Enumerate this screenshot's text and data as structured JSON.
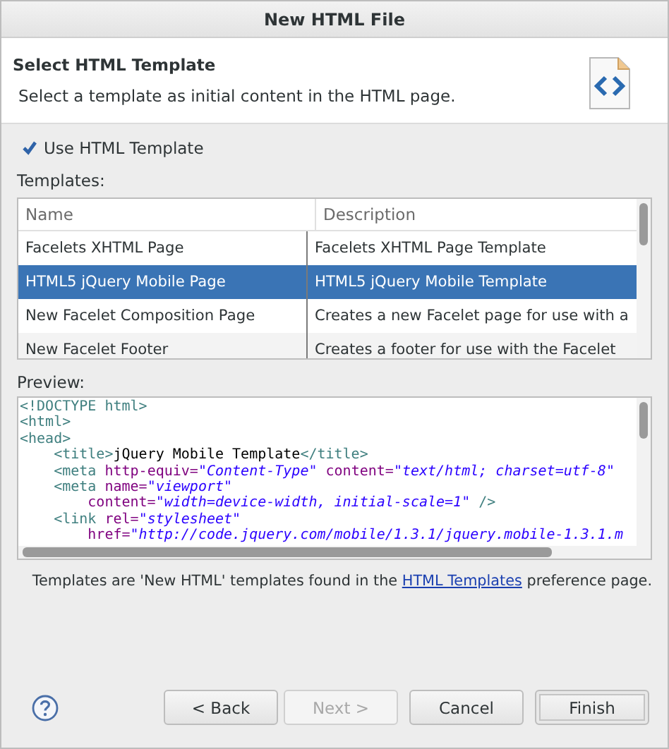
{
  "window": {
    "title": "New HTML File"
  },
  "header": {
    "title": "Select HTML Template",
    "description": "Select a template as initial content in the HTML page."
  },
  "use_template": {
    "label": "Use HTML Template",
    "checked": true
  },
  "templates": {
    "label": "Templates:",
    "columns": [
      "Name",
      "Description"
    ],
    "rows": [
      {
        "name": "Facelets XHTML Page",
        "description": "Facelets XHTML Page Template",
        "selected": false
      },
      {
        "name": "HTML5 jQuery Mobile Page",
        "description": "HTML5 jQuery Mobile Template",
        "selected": true
      },
      {
        "name": "New Facelet Composition Page",
        "description": "Creates a new Facelet page for use with a",
        "selected": false
      },
      {
        "name": "New Facelet Footer",
        "description": "Creates a footer for use with the Facelet",
        "selected": false
      }
    ]
  },
  "preview": {
    "label": "Preview:",
    "lines": [
      [
        {
          "kind": "tag",
          "text": "<!DOCTYPE html>"
        }
      ],
      [
        {
          "kind": "tag",
          "text": "<html>"
        }
      ],
      [
        {
          "kind": "tag",
          "text": "<head>"
        }
      ],
      [
        {
          "kind": "tag",
          "text": "    <title>"
        },
        {
          "kind": "text",
          "text": "jQuery Mobile Template"
        },
        {
          "kind": "tag",
          "text": "</title>"
        }
      ],
      [
        {
          "kind": "tag",
          "text": "    <meta "
        },
        {
          "kind": "attr",
          "text": "http-equiv="
        },
        {
          "kind": "value",
          "text": "\"Content-Type\""
        },
        {
          "kind": "attr",
          "text": " content="
        },
        {
          "kind": "value",
          "text": "\"text/html; charset=utf-8\""
        }
      ],
      [
        {
          "kind": "tag",
          "text": "    <meta "
        },
        {
          "kind": "attr",
          "text": "name="
        },
        {
          "kind": "value",
          "text": "\"viewport\""
        }
      ],
      [
        {
          "kind": "attr",
          "text": "        content="
        },
        {
          "kind": "value",
          "text": "\"width=device-width, initial-scale=1\""
        },
        {
          "kind": "tag",
          "text": " />"
        }
      ],
      [
        {
          "kind": "tag",
          "text": "    <link "
        },
        {
          "kind": "attr",
          "text": "rel="
        },
        {
          "kind": "value",
          "text": "\"stylesheet\""
        }
      ],
      [
        {
          "kind": "attr",
          "text": "        href="
        },
        {
          "kind": "value",
          "text": "\"http://code.jquery.com/mobile/1.3.1/jquery.mobile-1.3.1.m"
        }
      ]
    ]
  },
  "note": {
    "before": "Templates are 'New HTML' templates found in the",
    "link": "HTML Templates",
    "after": "preference page."
  },
  "buttons": [
    {
      "label": "< Back",
      "disabled": false,
      "default": false
    },
    {
      "label": "Next >",
      "disabled": true,
      "default": false
    },
    {
      "label": "Cancel",
      "disabled": false,
      "default": false
    },
    {
      "label": "Finish",
      "disabled": false,
      "default": true
    }
  ]
}
